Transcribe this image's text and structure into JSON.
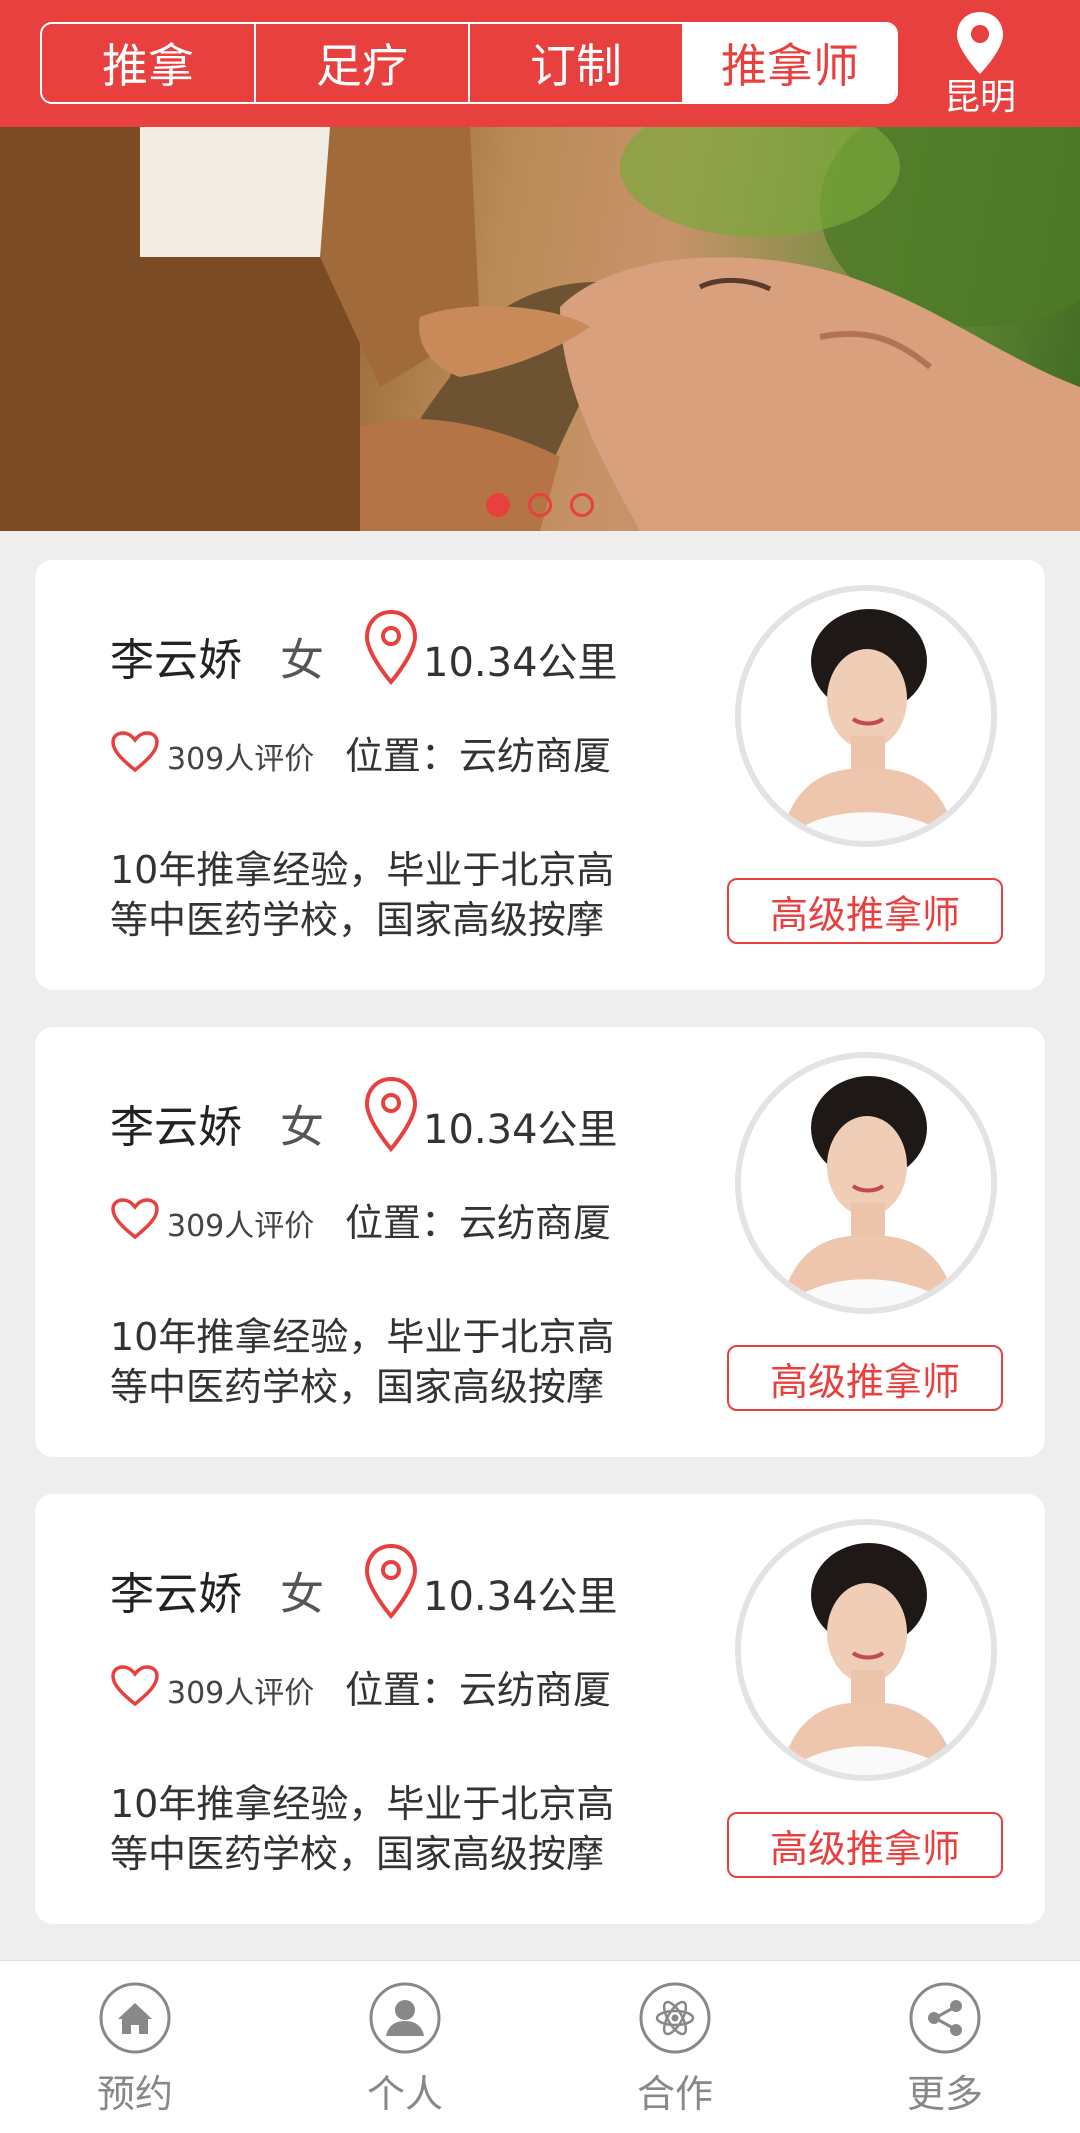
{
  "header": {
    "tabs": [
      {
        "label": "推拿",
        "active": false
      },
      {
        "label": "足疗",
        "active": false
      },
      {
        "label": "订制",
        "active": false
      },
      {
        "label": "推拿师",
        "active": true
      }
    ],
    "city": {
      "label": "昆明",
      "icon": "location-pin-icon"
    }
  },
  "banner": {
    "slide_count": 3,
    "active_slide": 1
  },
  "therapists": [
    {
      "name": "李云娇",
      "gender": "女",
      "distance": "10.34公里",
      "reviews": "309人评价",
      "location": "位置：云纺商厦",
      "description_line1": "10年推拿经验，毕业于北京高",
      "description_line2": "等中医药学校，国家高级按摩",
      "level": "高级推拿师"
    },
    {
      "name": "李云娇",
      "gender": "女",
      "distance": "10.34公里",
      "reviews": "309人评价",
      "location": "位置：云纺商厦",
      "description_line1": "10年推拿经验，毕业于北京高",
      "description_line2": "等中医药学校，国家高级按摩",
      "level": "高级推拿师"
    },
    {
      "name": "李云娇",
      "gender": "女",
      "distance": "10.34公里",
      "reviews": "309人评价",
      "location": "位置：云纺商厦",
      "description_line1": "10年推拿经验，毕业于北京高",
      "description_line2": "等中医药学校，国家高级按摩",
      "level": "高级推拿师"
    }
  ],
  "bottom_nav": [
    {
      "label": "预约",
      "icon": "home-icon"
    },
    {
      "label": "个人",
      "icon": "user-icon"
    },
    {
      "label": "合作",
      "icon": "atom-icon"
    },
    {
      "label": "更多",
      "icon": "share-icon"
    }
  ],
  "colors": {
    "accent": "#e8403e",
    "background": "#eeeeee",
    "card": "#ffffff",
    "nav_text": "#888888"
  }
}
